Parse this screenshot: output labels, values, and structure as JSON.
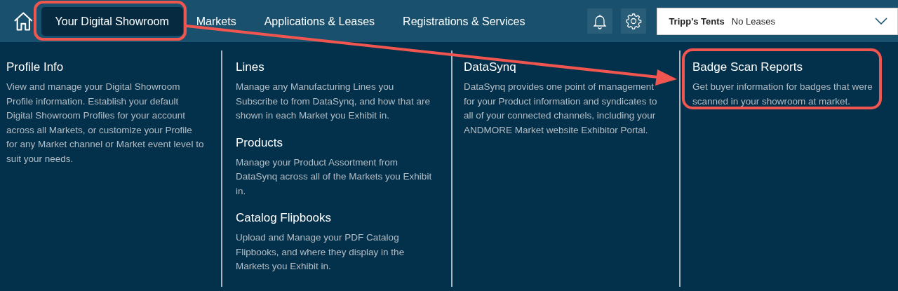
{
  "nav": {
    "tabs": [
      {
        "label": "Your Digital Showroom",
        "selected": true
      },
      {
        "label": "Markets",
        "selected": false
      },
      {
        "label": "Applications & Leases",
        "selected": false
      },
      {
        "label": "Registrations & Services",
        "selected": false
      }
    ],
    "account": {
      "name": "Tripp's Tents",
      "leases": "No Leases"
    }
  },
  "menu": {
    "columns": [
      {
        "sections": [
          {
            "title": "Profile Info",
            "description": "View and manage your Digital Showroom Profile information. Establish your default Digital Showroom Profiles for your account across all Markets, or customize your Profile for any Market channel or Market event level to suit your needs."
          }
        ]
      },
      {
        "sections": [
          {
            "title": "Lines",
            "description": "Manage any Manufacturing Lines you Subscribe to from DataSynq, and how that are shown in each Market you Exhibit in."
          },
          {
            "title": "Products",
            "description": "Manage your Product Assortment from DataSynq across all of the Markets you Exhibit in."
          },
          {
            "title": "Catalog Flipbooks",
            "description": "Upload and Manage your PDF Catalog Flipbooks, and where they display in the Markets you Exhibit in."
          }
        ]
      },
      {
        "sections": [
          {
            "title": "DataSynq",
            "description": "DataSynq provides one point of management for your Product information and syndicates to all of your connected channels, including your ANDMORE Market website Exhibitor Portal."
          }
        ]
      },
      {
        "sections": [
          {
            "title": "Badge Scan Reports",
            "description": "Get buyer information for badges that were scanned in your showroom at market."
          }
        ]
      }
    ]
  },
  "annotation": {
    "color": "#f0564f"
  }
}
